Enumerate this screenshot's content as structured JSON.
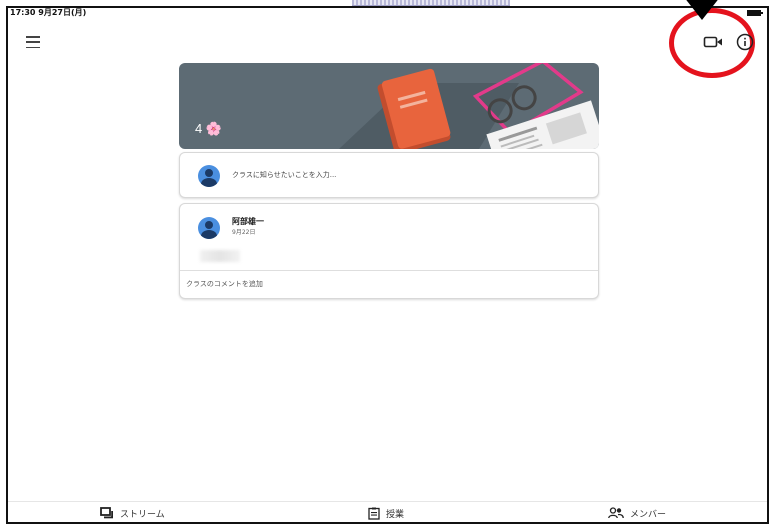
{
  "status_bar": {
    "time": "17:30  9月27日(月)"
  },
  "banner": {
    "class_name": "4 🌸"
  },
  "announce": {
    "placeholder": "クラスに知らせたいことを入力..."
  },
  "post": {
    "author": "阿部雄一",
    "date": "9月22日",
    "comment_link": "クラスのコメントを追加"
  },
  "nav": {
    "stream": "ストリーム",
    "classwork": "授業",
    "members": "メンバー"
  },
  "colors": {
    "banner_bg": "#5d6b74",
    "highlight_circle": "#e4131d",
    "avatar": "#4a8fe0",
    "book": "#e8643d",
    "glasses": "#e23a8a"
  },
  "icons": [
    "menu-icon",
    "video-camera-icon",
    "info-icon",
    "stream-icon",
    "classwork-icon",
    "members-icon",
    "arrow-pointer-icon"
  ]
}
